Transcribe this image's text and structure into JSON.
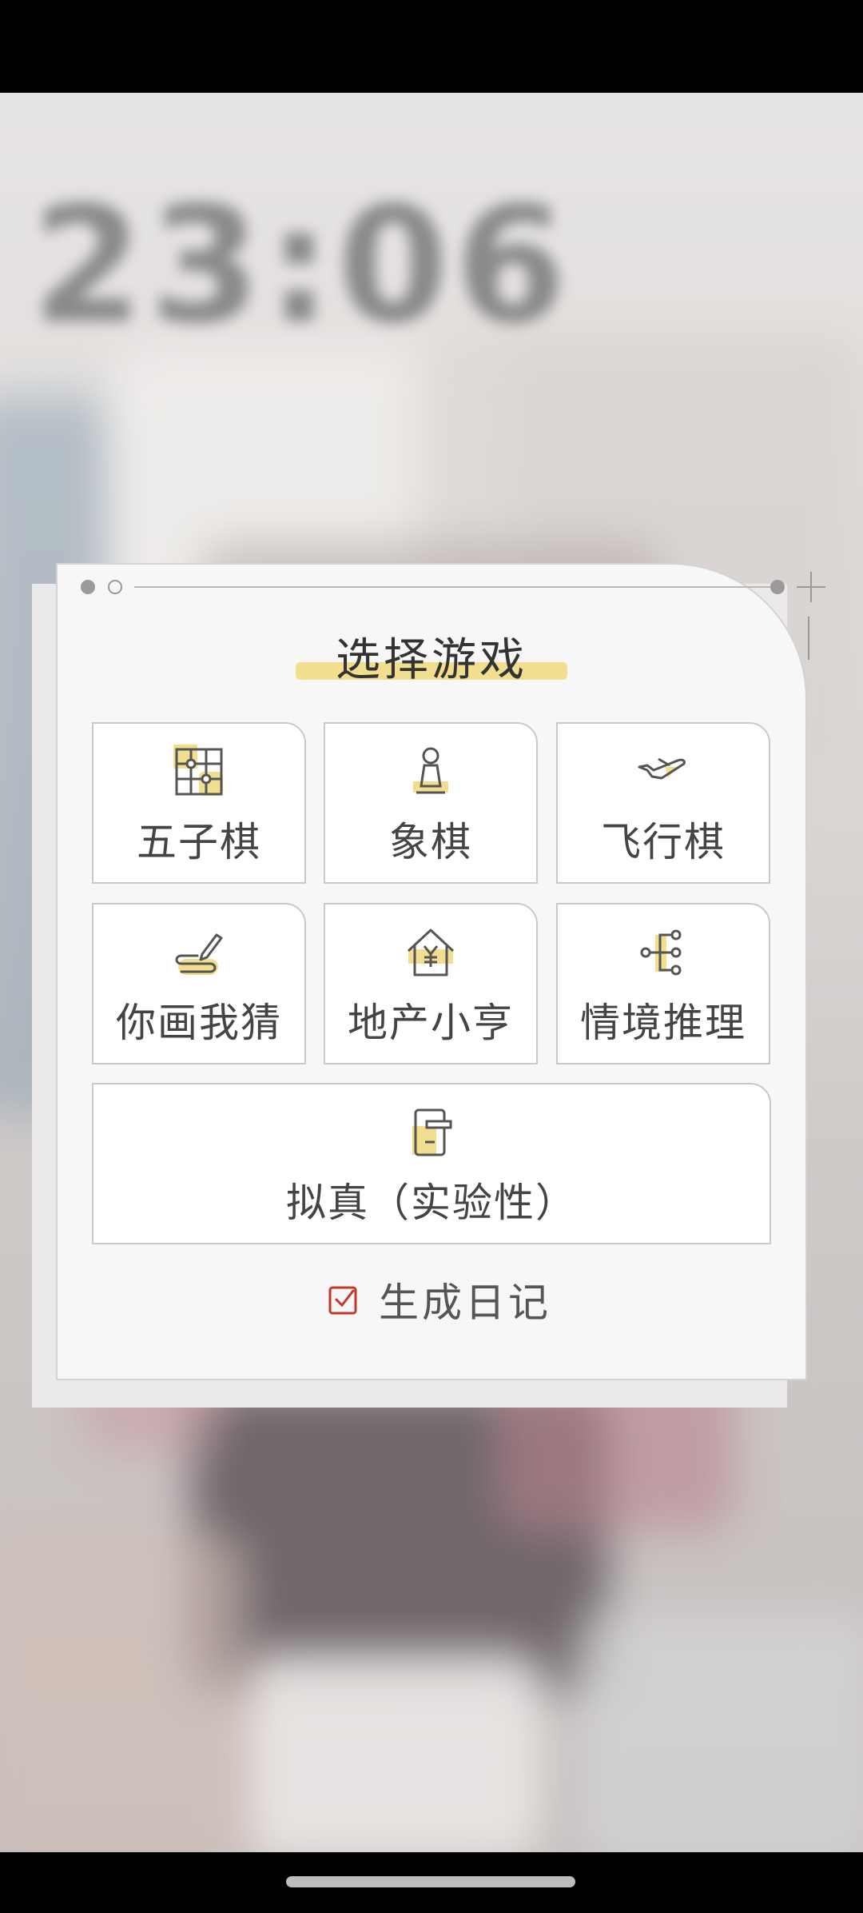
{
  "background": {
    "clock": "23:06",
    "date": "",
    "weather": ""
  },
  "dialog": {
    "title": "选择游戏",
    "games": [
      {
        "label": "五子棋",
        "icon": "gomoku-board-icon"
      },
      {
        "label": "象棋",
        "icon": "chess-pawn-icon"
      },
      {
        "label": "飞行棋",
        "icon": "airplane-icon"
      },
      {
        "label": "你画我猜",
        "icon": "pencil-draw-icon"
      },
      {
        "label": "地产小亨",
        "icon": "property-house-icon"
      },
      {
        "label": "情境推理",
        "icon": "reasoning-tree-icon"
      },
      {
        "label": "拟真（实验性）",
        "icon": "door-handle-icon"
      }
    ],
    "diary_option": {
      "label": "生成日记",
      "checked": true
    }
  },
  "colors": {
    "accent_yellow": "#f1de8e",
    "checkbox_red": "#c0392b",
    "text_dark": "#333333"
  }
}
